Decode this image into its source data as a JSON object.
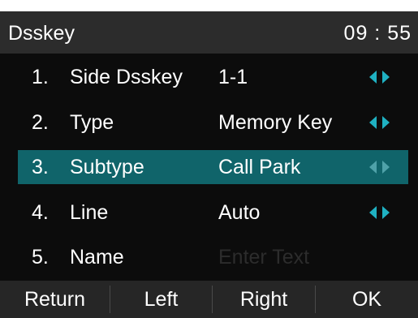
{
  "header": {
    "title": "Dsskey",
    "time": "09 : 55"
  },
  "rows": [
    {
      "num": "1.",
      "label": "Side Dsskey",
      "value": "1-1",
      "selected": false
    },
    {
      "num": "2.",
      "label": "Type",
      "value": "Memory Key",
      "selected": false
    },
    {
      "num": "3.",
      "label": "Subtype",
      "value": "Call Park",
      "selected": true
    },
    {
      "num": "4.",
      "label": "Line",
      "value": "Auto",
      "selected": false
    },
    {
      "num": "5.",
      "label": "Name",
      "placeholder": "Enter Text",
      "selected": false
    }
  ],
  "softkeys": {
    "return": "Return",
    "left": "Left",
    "right": "Right",
    "ok": "OK"
  },
  "colors": {
    "selected_row": "#10646a",
    "arrow": "#1fb1c2",
    "titlebar": "#2c2c2c",
    "softkey_bar": "#262626",
    "background": "#0c0c0c"
  },
  "icons": {
    "arrows": "left-right-arrows-icon"
  }
}
